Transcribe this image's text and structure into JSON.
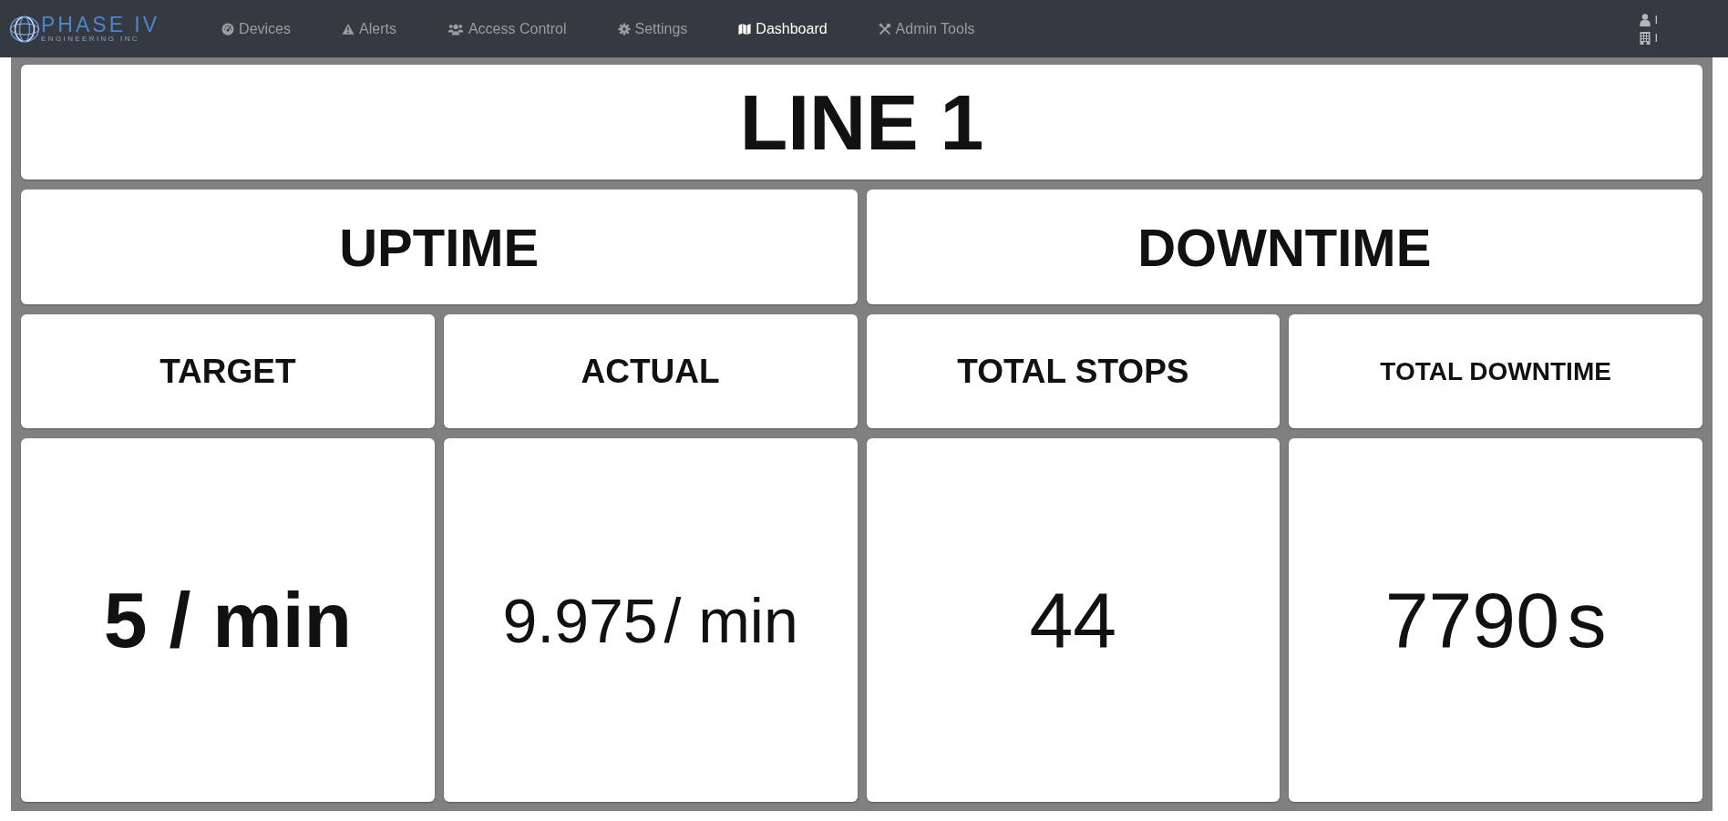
{
  "navbar": {
    "logo": {
      "name": "PHASE IV",
      "tagline": "ENGINEERING INC"
    },
    "items": [
      {
        "label": "Devices",
        "selected": false
      },
      {
        "label": "Alerts",
        "selected": false
      },
      {
        "label": "Access Control",
        "selected": false
      },
      {
        "label": "Settings",
        "selected": false
      },
      {
        "label": "Dashboard",
        "selected": true
      },
      {
        "label": "Admin Tools",
        "selected": false
      }
    ],
    "user": {
      "name": "I",
      "organization": "I"
    }
  },
  "dashboard": {
    "title": "LINE 1",
    "sections": [
      {
        "title": "UPTIME"
      },
      {
        "title": "DOWNTIME"
      }
    ],
    "metrics": [
      {
        "label": "TARGET",
        "value": "5 / min",
        "bold": true
      },
      {
        "label": "ACTUAL",
        "value": "9.975",
        "unit": "/ min",
        "bold": false
      },
      {
        "label": "TOTAL STOPS",
        "value": "44",
        "bold": false
      },
      {
        "label": "TOTAL DOWNTIME",
        "value": "7790",
        "unit": "s",
        "bold": false
      }
    ]
  }
}
